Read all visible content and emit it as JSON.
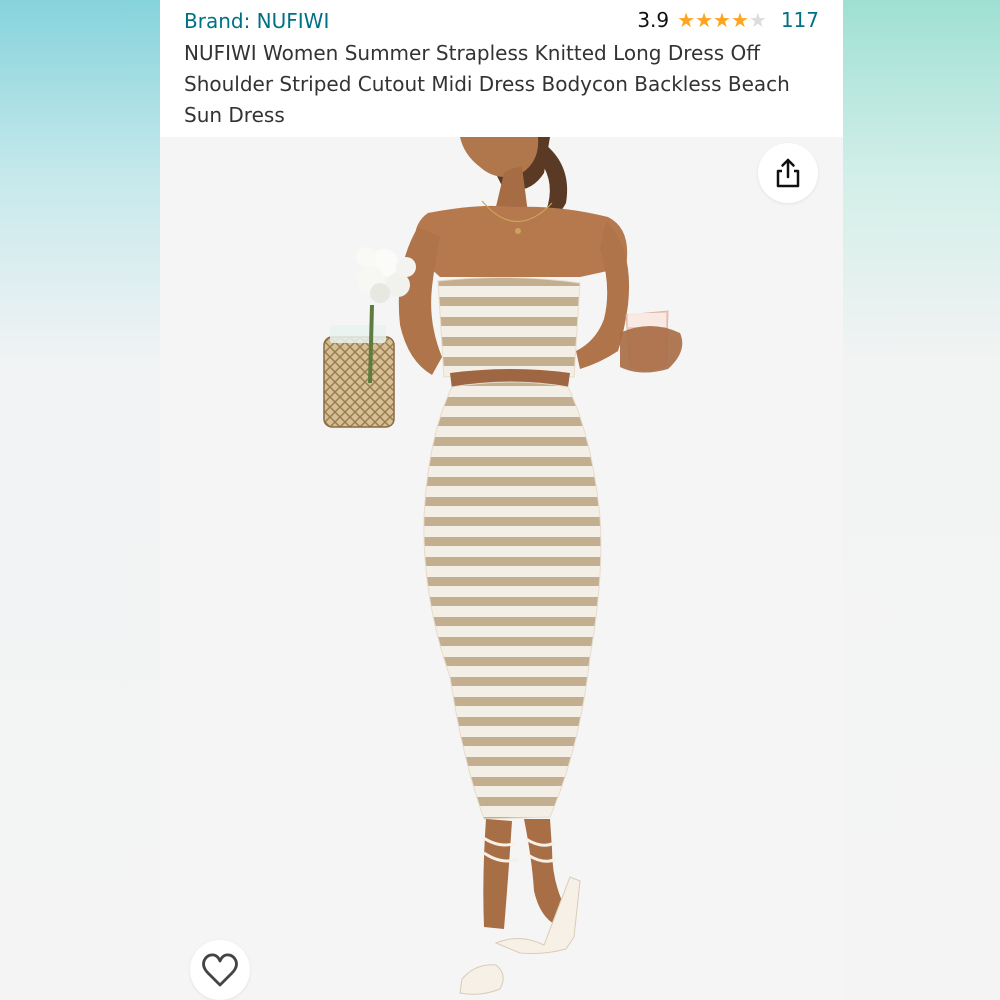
{
  "product": {
    "brand_label": "Brand: NUFIWI",
    "rating": "3.9",
    "rating_stars": 3.9,
    "rating_count": "117",
    "title": "NUFIWI Women Summer Strapless Knitted Long Dress Off Shoulder Striped Cutout Midi Dress Bodycon Backless Beach Sun Dress"
  },
  "icons": {
    "share": "share-icon",
    "favorite": "heart-icon",
    "star": "star-icon"
  },
  "colors": {
    "link": "#007185",
    "star": "#ffa41c",
    "star_empty": "#dddddd",
    "text": "#333333",
    "dress_stripe": "#c3af8f",
    "dress_base": "#f4efe6"
  }
}
